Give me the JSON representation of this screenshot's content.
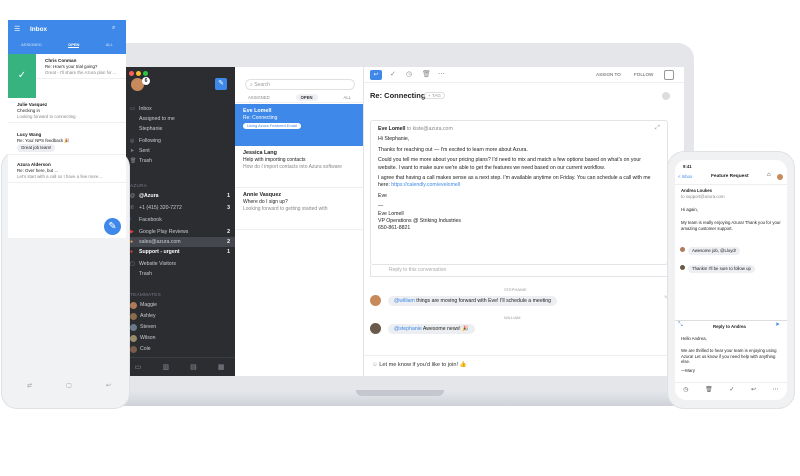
{
  "sidebar": {
    "items": [
      {
        "label": "Inbox",
        "count": "",
        "icon": "inbox-icon"
      },
      {
        "label": "Assigned to me",
        "count": ""
      },
      {
        "label": "Stephanie",
        "count": ""
      },
      {
        "label": "Following",
        "count": ""
      },
      {
        "label": "Sent",
        "count": ""
      },
      {
        "label": "Trash",
        "count": ""
      }
    ],
    "section_azura": "AZURA",
    "azura_items": [
      {
        "label": "@Azura",
        "count": "1",
        "bold": true
      },
      {
        "label": "+1 (415) 320-7272",
        "count": "3"
      },
      {
        "label": "Facebook",
        "count": ""
      },
      {
        "label": "Google Play Reviews",
        "count": "2"
      },
      {
        "label": "sales@azura.com",
        "count": "2"
      },
      {
        "label": "Support - urgent",
        "count": "1",
        "bold": true
      },
      {
        "label": "Website Visitors",
        "count": ""
      },
      {
        "label": "Trash",
        "count": ""
      }
    ],
    "section_team": "TEAMMATES",
    "team": [
      {
        "label": "Maggie"
      },
      {
        "label": "Ashley"
      },
      {
        "label": "Steven"
      },
      {
        "label": "Wilson"
      },
      {
        "label": "Cole"
      }
    ]
  },
  "list": {
    "search_placeholder": "Search",
    "tabs": [
      "ASSIGNED",
      "OPEN",
      "ALL"
    ],
    "conversations": [
      {
        "name": "Eve Lomell",
        "preview1": "Re: Connecting",
        "tag": "Using Azura Featured Email",
        "selected": true
      },
      {
        "name": "Jessica Lang",
        "preview1": "Help with importing contacts",
        "preview2": "How do I import contacts into Azura software"
      },
      {
        "name": "Annie Vasquez",
        "preview1": "Where do I sign up?",
        "preview2": "Looking forward to getting started with"
      }
    ]
  },
  "main": {
    "toolbar": {
      "assign": "ASSIGN TO",
      "follow": "FOLLOW"
    },
    "subject": "Re: Connecting",
    "tag_add": "+ TAG",
    "email": {
      "from": "Eve Lomell",
      "to": "to kiste@azura.com",
      "greeting": "Hi Stephanie,",
      "p1": "Thanks for reaching out — I'm excited to learn more about Azura.",
      "p2": "Could you tell me more about your pricing plans? I'd need to mix and match a few options based on what's on your website. I want to make sure we're able to get the features we need based on our current workflow.",
      "p3a": "I agree that having a call makes sense as a next step. I'm available anytime on Friday. You can schedule a call with me here: ",
      "p3link": "https://calendly.com/evelomell",
      "signoff": "Eve",
      "sig1": "Eve Lomell",
      "sig2": "VP Operations @ Striking Industries",
      "sig3": "650-861-8821",
      "reply": "Reply to this conversation"
    },
    "comments": [
      {
        "author": "STEPHANIE",
        "mention": "@william",
        "text": " things are moving forward with Eve! I'll schedule a meeting"
      },
      {
        "author": "WILLIAM",
        "mention": "@stephanie",
        "text": " Awesome news! 🎉"
      }
    ],
    "compose": "Let me know if you'd like to join! 👍"
  },
  "android": {
    "title": "Inbox",
    "tabs": [
      "ASSIGNED",
      "OPEN",
      "ALL"
    ],
    "messages": [
      {
        "name": "Chris Conman",
        "line1": "Re: How's your trial going?",
        "line2": "Great - I'll share the Azura plan for ..."
      },
      {
        "name": "Julie Vasquez",
        "line1": "Checking in",
        "line2": "Looking forward to connecting"
      },
      {
        "name": "Lucy Wang",
        "line1": "Re: Your NPS feedback 🎉",
        "line2": "Great job team!"
      },
      {
        "name": "Azura Alderson",
        "line1": "Re: Over here, but ...",
        "line2": "Let's start with a call so I have a few more..."
      }
    ]
  },
  "iphone": {
    "time": "9:41",
    "back": "< Inbox",
    "title": "Feature Request",
    "msg_from": "Andrea Loukes",
    "msg_sub": "to support@azura.com",
    "greet": "Hi again,",
    "body": "My team is really enjoying Azura! Thank you for your amazing customer support.",
    "c1": "Awesome job, @Lloyd!",
    "c2": "Thanks! I'll be sure to follow up",
    "reply_title": "Reply to Andrea",
    "reply_body": "Hello Andrea,",
    "reply_text": "We are thrilled to hear your team is enjoying using Azura! Let us know if you need help with anything else.",
    "sig": "—Mary"
  }
}
